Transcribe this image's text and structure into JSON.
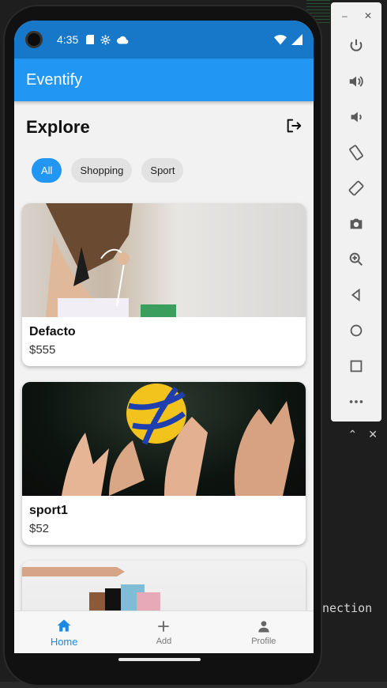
{
  "status_bar": {
    "time": "4:35"
  },
  "app_bar": {
    "title": "Eventify"
  },
  "page": {
    "title": "Explore"
  },
  "filters": [
    {
      "label": "All",
      "selected": true
    },
    {
      "label": "Shopping",
      "selected": false
    },
    {
      "label": "Sport",
      "selected": false
    }
  ],
  "events": [
    {
      "name": "Defacto",
      "price": "$555",
      "image": "woman-with-shopping-bags"
    },
    {
      "name": "sport1",
      "price": "$52",
      "image": "volleyball-hands"
    },
    {
      "name": "",
      "price": "",
      "image": "shopping-bags"
    }
  ],
  "bottom_nav": {
    "home": "Home",
    "add": "Add",
    "profile": "Profile"
  },
  "ide": {
    "terminal_text": "nection"
  },
  "colors": {
    "primary": "#2196f3",
    "status_bar": "#1778c9"
  }
}
